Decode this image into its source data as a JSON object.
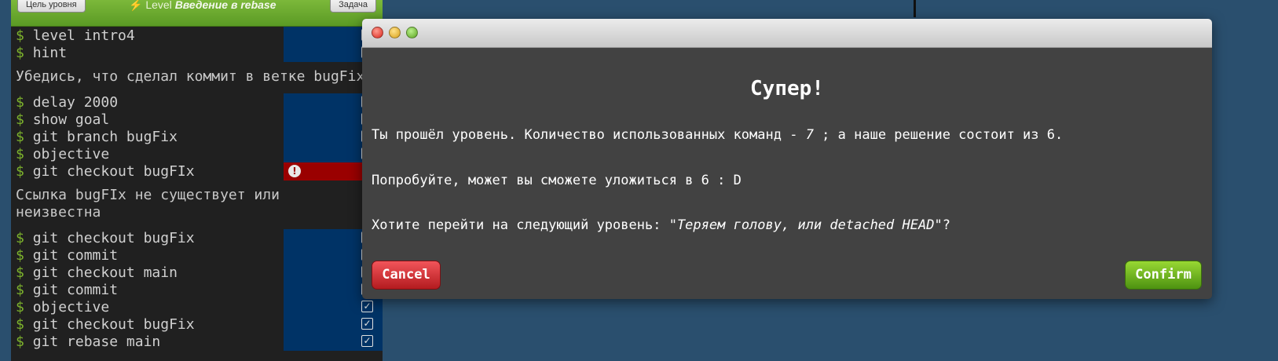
{
  "top_bar": {
    "goal_button": "Цель уровня",
    "level_prefix": "Level",
    "level_name": "Введение в rebase",
    "task_button": "Задача"
  },
  "terminal": {
    "prompt": "$",
    "commands_a": [
      "level intro4",
      "hint"
    ],
    "info_1": "Убедись, что сделал коммит в ветке bugFix",
    "commands_b": [
      "delay 2000",
      "show goal",
      "git branch bugFix",
      "objective"
    ],
    "error_command": "git checkout bugFIx",
    "info_2_line1": "Ссылка bugFIx не существует или",
    "info_2_line2": "неизвестна",
    "commands_c": [
      "git checkout bugFix",
      "git commit",
      "git checkout main",
      "git commit",
      "objective",
      "git checkout bugFix",
      "git rebase main"
    ],
    "check_mark": "✓",
    "error_mark": "!"
  },
  "modal": {
    "title": "Супер!",
    "line1_a": "Ты прошёл уровень. Количество использованных команд - ",
    "line1_count": "7",
    "line1_b": " ; а наше решение состоит из 6.",
    "line2": "Попробуйте, может вы сможете уложиться в 6 : D",
    "line3_a": "Хотите перейти на следующий уровень: \"",
    "line3_level": "Теряем голову, или detached HEAD",
    "line3_b": "\"?",
    "cancel_label": "Cancel",
    "confirm_label": "Confirm"
  },
  "colors": {
    "background": "#2a4f6e",
    "terminal": "#202020",
    "success_status": "#003366",
    "error_status": "#9a0000",
    "prompt": "#7db32c",
    "modal": "#424242"
  }
}
